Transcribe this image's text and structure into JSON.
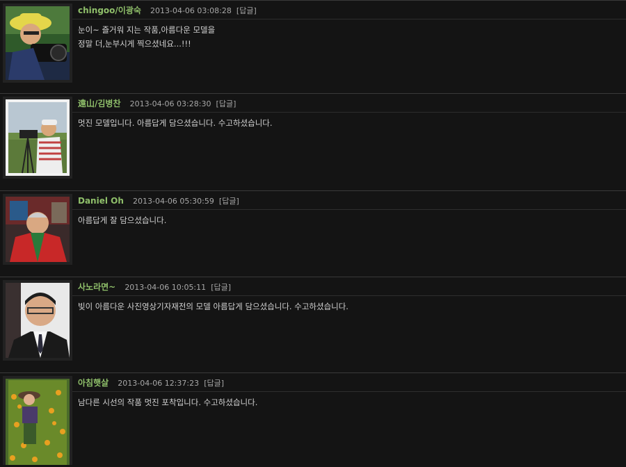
{
  "comments": [
    {
      "author": "chingoo/이광숙",
      "date": "2013-04-06 03:08:28",
      "reply": "[답글]",
      "lines": [
        "눈이~ 즐거워 지는 작품,아름다운 모델을",
        "정말 더,눈부시게 찍으셨네요...!!!"
      ]
    },
    {
      "author": "遠山/김병찬",
      "date": "2013-04-06 03:28:30",
      "reply": "[답글]",
      "lines": [
        "멋진 모델입니다. 아름답게 담으셨습니다. 수고하셨습니다."
      ]
    },
    {
      "author": "Daniel Oh",
      "date": "2013-04-06 05:30:59",
      "reply": "[답글]",
      "lines": [
        "아름답게 잘 담으셨습니다."
      ]
    },
    {
      "author": "사노라면~",
      "date": "2013-04-06 10:05:11",
      "reply": "[답글]",
      "lines": [
        "빛이 아름다운 사진영상기자재전의 모델 아름답게 담으셨습니다. 수고하셨습니다."
      ]
    },
    {
      "author": "아침햇살",
      "date": "2013-04-06 12:37:23",
      "reply": "[답글]",
      "lines": [
        "남다른 시선의 작품 멋진 포착입니다. 수고하셨습니다."
      ]
    }
  ]
}
